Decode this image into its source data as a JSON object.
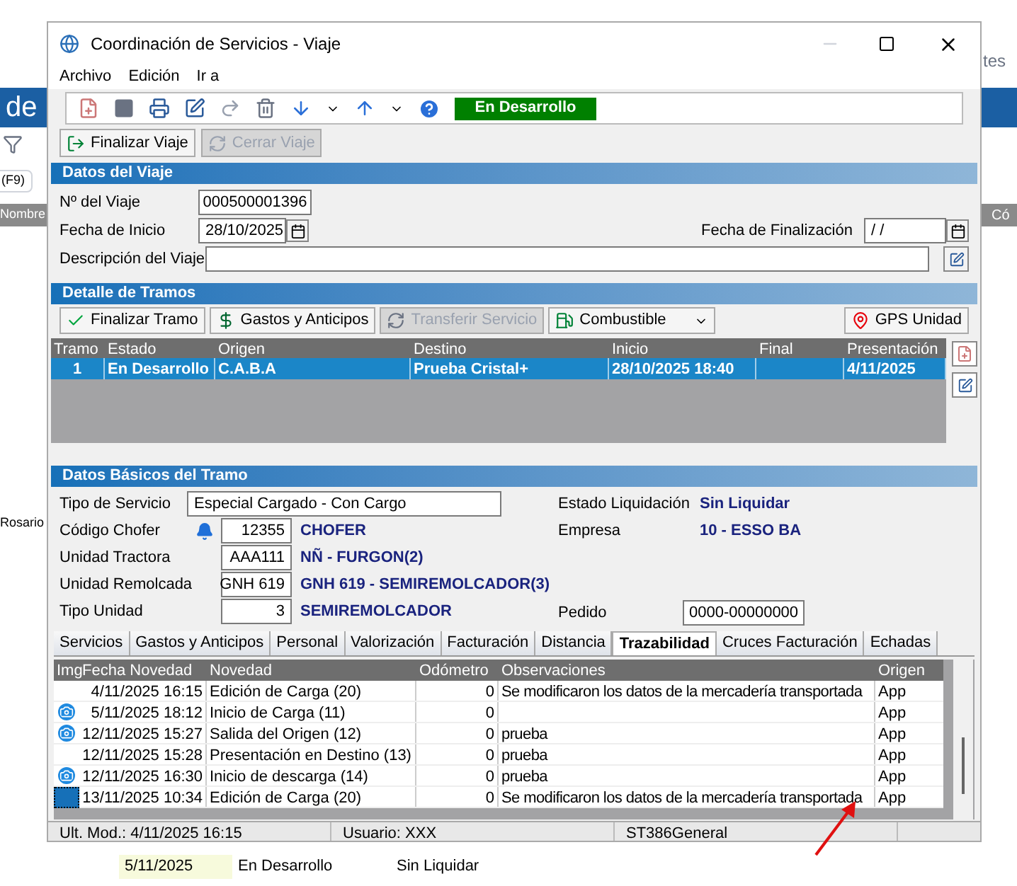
{
  "background_app": {
    "heading": "de",
    "shortcut": "(F9)",
    "column_1": "Nombre",
    "column_2": "Có",
    "side_text": "Rosario",
    "corner_text": "tes",
    "rows": [
      {
        "date": "5/11/2025",
        "estado": "En Desarrollo",
        "liquidacion": "Sin Liquidar"
      }
    ]
  },
  "window": {
    "title": "Coordinación de Servicios - Viaje"
  },
  "menu": [
    "Archivo",
    "Edición",
    "Ir a"
  ],
  "toolbar": {
    "status": "En Desarrollo"
  },
  "actions": [
    {
      "label": "Finalizar Viaje",
      "disabled": false
    },
    {
      "label": "Cerrar Viaje",
      "disabled": true
    }
  ],
  "datos_viaje": {
    "title": "Datos del Viaje",
    "numero_label": "Nº del Viaje",
    "numero": "000500001396",
    "inicio_label": "Fecha de Inicio",
    "inicio": "28/10/2025",
    "fin_label": "Fecha de Finalización",
    "fin": "/ /",
    "descripcion_label": "Descripción del Viaje"
  },
  "detalle_tramos": {
    "title": "Detalle de Tramos",
    "buttons": [
      {
        "label": "Finalizar Tramo",
        "kind": "check",
        "disabled": false
      },
      {
        "label": "Gastos y Anticipos",
        "kind": "money",
        "disabled": false
      },
      {
        "label": "Transferir Servicio",
        "kind": "transfer",
        "disabled": true
      },
      {
        "label": "Combustible",
        "kind": "dropdown",
        "disabled": false
      }
    ],
    "gps_button": "GPS Unidad",
    "columns": [
      "Tramo",
      "Estado",
      "Origen",
      "Destino",
      "Inicio",
      "Final",
      "Presentación"
    ],
    "rows": [
      {
        "cells": [
          "1",
          "En Desarrollo",
          "C.A.B.A",
          "Prueba Cristal+",
          "28/10/2025 18:40",
          "",
          "4/11/2025"
        ],
        "selected": true
      }
    ]
  },
  "datos_basicos": {
    "title": "Datos Básicos del Tramo",
    "tipo_servicio_label": "Tipo de Servicio",
    "tipo_servicio": "Especial Cargado - Con Cargo",
    "fields": [
      {
        "label": "Código Chofer",
        "value": "12355",
        "description": "CHOFER",
        "bell": true
      },
      {
        "label": "Unidad Tractora",
        "value": "AAA111",
        "description": "NÑ - FURGON(2)",
        "bell": false
      },
      {
        "label": "Unidad Remolcada",
        "value": "GNH 619",
        "description": "GNH 619 - SEMIREMOLCADOR(3)",
        "bell": false
      },
      {
        "label": "Tipo Unidad",
        "value": "3",
        "description": "SEMIREMOLCADOR",
        "bell": false
      }
    ],
    "estado_label": "Estado Liquidación",
    "estado": "Sin Liquidar",
    "empresa_label": "Empresa",
    "empresa": "10 - ESSO BA",
    "pedido_label": "Pedido",
    "pedido": "0000-00000000"
  },
  "tabs": [
    {
      "label": "Servicios",
      "selected": false
    },
    {
      "label": "Gastos y Anticipos",
      "selected": false
    },
    {
      "label": "Personal",
      "selected": false
    },
    {
      "label": "Valorización",
      "selected": false
    },
    {
      "label": "Facturación",
      "selected": false
    },
    {
      "label": "Distancia",
      "selected": false
    },
    {
      "label": "Trazabilidad",
      "selected": true
    },
    {
      "label": "Cruces Facturación",
      "selected": false
    },
    {
      "label": "Echadas",
      "selected": false
    }
  ],
  "trazabilidad": {
    "columns": [
      "Img",
      "Fecha Novedad",
      "Novedad",
      "Odómetro",
      "Observaciones",
      "Origen"
    ],
    "rows": [
      {
        "photo": false,
        "selected": false,
        "fecha": "4/11/2025 16:15",
        "novedad": "Edición de Carga (20)",
        "odometro": "0",
        "observaciones": "Se modificaron los datos de la mercadería transportada",
        "origen": "App"
      },
      {
        "photo": true,
        "selected": false,
        "fecha": "5/11/2025 18:12",
        "novedad": "Inicio de Carga (11)",
        "odometro": "0",
        "observaciones": "",
        "origen": "App"
      },
      {
        "photo": true,
        "selected": false,
        "fecha": "12/11/2025 15:27",
        "novedad": "Salida del Origen (12)",
        "odometro": "0",
        "observaciones": "prueba",
        "origen": "App"
      },
      {
        "photo": false,
        "selected": false,
        "fecha": "12/11/2025 15:28",
        "novedad": "Presentación en Destino (13)",
        "odometro": "0",
        "observaciones": "prueba",
        "origen": "App"
      },
      {
        "photo": true,
        "selected": false,
        "fecha": "12/11/2025 16:30",
        "novedad": "Inicio de descarga (14)",
        "odometro": "0",
        "observaciones": "prueba",
        "origen": "App"
      },
      {
        "photo": false,
        "selected": true,
        "fecha": "13/11/2025 10:34",
        "novedad": "Edición de Carga (20)",
        "odometro": "0",
        "observaciones": "Se modificaron los datos de la mercadería transportada",
        "origen": "App"
      }
    ]
  },
  "status_bar": [
    "Ult. Mod.: 4/11/2025 16:15",
    "Usuario: XXX",
    "ST386General"
  ]
}
